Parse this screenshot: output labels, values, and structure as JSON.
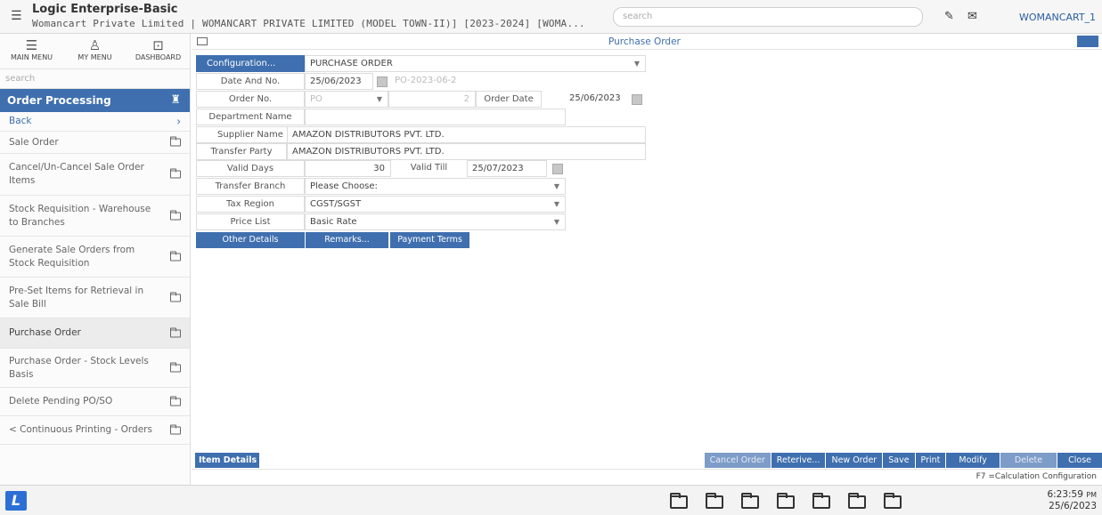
{
  "header": {
    "title": "Logic Enterprise-Basic",
    "subtitle": "Womancart Private Limited | WOMANCART PRIVATE LIMITED (MODEL TOWN-II)] [2023-2024] [WOMA...",
    "search_placeholder": "search",
    "user": "WOMANCART_1",
    "icons": [
      "menu-icon",
      "tools-icon",
      "mail-icon"
    ]
  },
  "sidebar": {
    "tabs": [
      {
        "label": "MAIN MENU",
        "icon": "hamburger-icon"
      },
      {
        "label": "MY MENU",
        "icon": "user-icon"
      },
      {
        "label": "DASHBOARD",
        "icon": "dashboard-icon"
      }
    ],
    "search_placeholder": "search",
    "section_title": "Order Processing",
    "back_label": "Back",
    "items": [
      {
        "label": "Sale Order"
      },
      {
        "label": "Cancel/Un-Cancel Sale Order Items"
      },
      {
        "label": "Stock Requisition - Warehouse to Branches"
      },
      {
        "label": "Generate Sale Orders from Stock Requisition"
      },
      {
        "label": "Pre-Set Items for Retrieval in Sale Bill"
      },
      {
        "label": "Purchase Order"
      },
      {
        "label": "Purchase Order - Stock Levels Basis"
      },
      {
        "label": "Delete Pending PO/SO"
      },
      {
        "label": "< Continuous Printing - Orders"
      }
    ]
  },
  "form": {
    "title": "Purchase Order",
    "configuration_label": "Configuration...",
    "configuration_value": "PURCHASE ORDER",
    "date_and_no_label": "Date And No.",
    "date_value": "25/06/2023",
    "doc_no": "PO-2023-06-2",
    "order_no_label": "Order No.",
    "order_no_prefix": "PO",
    "order_no_value": "2",
    "order_date_label": "Order Date",
    "order_date_value": "25/06/2023",
    "department_label": "Department Name",
    "department_value": "",
    "supplier_label": "Supplier Name",
    "supplier_value": "AMAZON DISTRIBUTORS PVT. LTD.",
    "transfer_party_label": "Transfer Party",
    "transfer_party_value": "AMAZON DISTRIBUTORS PVT. LTD.",
    "valid_days_label": "Valid Days",
    "valid_days_value": "30",
    "valid_till_label": "Valid Till",
    "valid_till_value": "25/07/2023",
    "transfer_branch_label": "Transfer Branch",
    "transfer_branch_value": "Please Choose:",
    "tax_region_label": "Tax Region",
    "tax_region_value": "CGST/SGST",
    "price_list_label": "Price List",
    "price_list_value": "Basic Rate",
    "tabs": {
      "other_details": "Other Details",
      "remarks": "Remarks...",
      "payment_terms": "Payment Terms"
    }
  },
  "footer": {
    "item_details": "Item Details",
    "actions": {
      "cancel_order": "Cancel Order",
      "retrieve": "Reterive...",
      "new_order": "New Order",
      "save": "Save",
      "print": "Print",
      "modify": "Modify",
      "delete": "Delete",
      "close": "Close"
    },
    "hint": "F7 =Calculation Configuration"
  },
  "taskbar": {
    "logo": "L",
    "time": "6:23:59",
    "ampm": "PM",
    "date": "25/6/2023"
  },
  "colors": {
    "accent": "#3f6fae",
    "disabled": "#7d9cc8"
  }
}
